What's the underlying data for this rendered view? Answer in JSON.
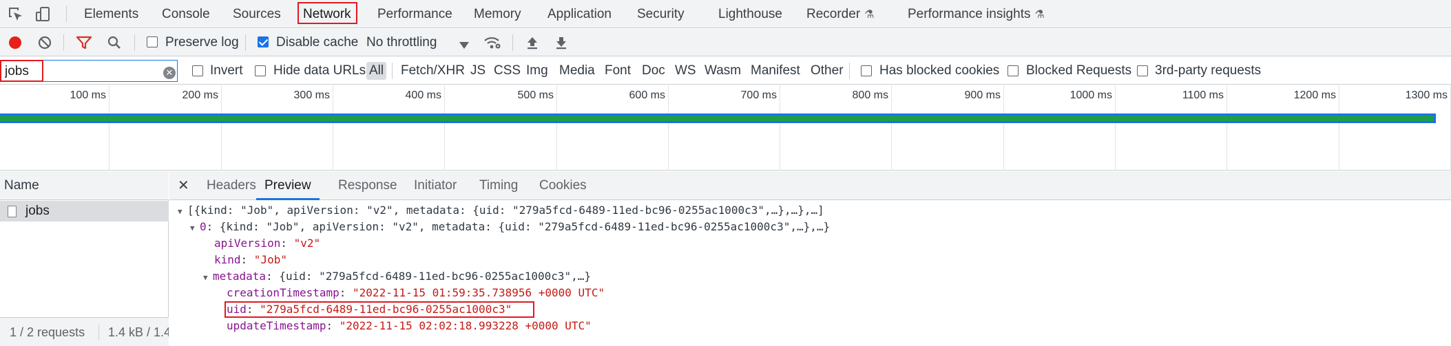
{
  "tabs": [
    {
      "label": "Elements"
    },
    {
      "label": "Console"
    },
    {
      "label": "Sources"
    },
    {
      "label": "Network"
    },
    {
      "label": "Performance"
    },
    {
      "label": "Memory"
    },
    {
      "label": "Application"
    },
    {
      "label": "Security"
    },
    {
      "label": "Lighthouse"
    },
    {
      "label": "Recorder"
    },
    {
      "label": "Performance insights"
    }
  ],
  "active_tab": "Network",
  "toolbar": {
    "preserve_log": "Preserve log",
    "preserve_log_checked": false,
    "disable_cache": "Disable cache",
    "disable_cache_checked": true,
    "throttling": "No throttling"
  },
  "filter": {
    "value": "jobs",
    "invert": "Invert",
    "hide_data_urls": "Hide data URLs",
    "types": [
      "All",
      "Fetch/XHR",
      "JS",
      "CSS",
      "Img",
      "Media",
      "Font",
      "Doc",
      "WS",
      "Wasm",
      "Manifest",
      "Other"
    ],
    "selected_type": "All",
    "has_blocked_cookies": "Has blocked cookies",
    "blocked_requests": "Blocked Requests",
    "third_party": "3rd-party requests"
  },
  "timeline": {
    "ticks": [
      "100 ms",
      "200 ms",
      "300 ms",
      "400 ms",
      "500 ms",
      "600 ms",
      "700 ms",
      "800 ms",
      "900 ms",
      "1000 ms",
      "1100 ms",
      "1200 ms",
      "1300 ms"
    ]
  },
  "requests": {
    "header": "Name",
    "items": [
      {
        "name": "jobs"
      }
    ],
    "status_count": "1 / 2 requests",
    "status_size": "1.4 kB / 1.4"
  },
  "details": {
    "tabs": [
      "Headers",
      "Preview",
      "Response",
      "Initiator",
      "Timing",
      "Cookies"
    ],
    "active": "Preview"
  },
  "preview": {
    "root": "[{kind: \"Job\", apiVersion: \"v2\", metadata: {uid: \"279a5fcd-6489-11ed-bc96-0255ac1000c3\",…},…},…]",
    "item_index": "0",
    "item_summary": "{kind: \"Job\", apiVersion: \"v2\", metadata: {uid: \"279a5fcd-6489-11ed-bc96-0255ac1000c3\",…},…}",
    "apiVersion_key": "apiVersion",
    "apiVersion_val": "\"v2\"",
    "kind_key": "kind",
    "kind_val": "\"Job\"",
    "metadata_key": "metadata",
    "metadata_summary": "{uid: \"279a5fcd-6489-11ed-bc96-0255ac1000c3\",…}",
    "creation_key": "creationTimestamp",
    "creation_val": "\"2022-11-15 01:59:35.738956 +0000 UTC\"",
    "uid_key": "uid",
    "uid_val": "\"279a5fcd-6489-11ed-bc96-0255ac1000c3\"",
    "update_key": "updateTimestamp",
    "update_val": "\"2022-11-15 02:02:18.993228 +0000 UTC\""
  },
  "colors": {
    "accent": "#1a73e8",
    "highlight_box": "#e0191f",
    "record": "#e8201b",
    "filter_icon": "#d93025",
    "waterfall_bar": "#1e9e4a"
  }
}
